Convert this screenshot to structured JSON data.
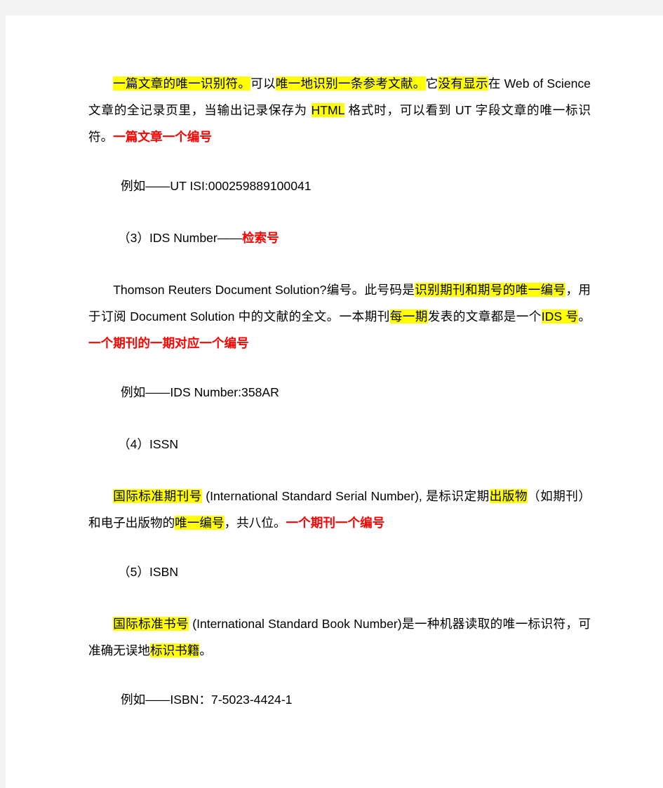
{
  "document": {
    "page_background": "#ffffff",
    "canvas_background": "#f4f4f4",
    "highlight_color": "#ffff00",
    "emphasis_color": "#ff0000",
    "text_color": "#000000",
    "paragraphs": [
      {
        "id": "ut-description",
        "type": "body",
        "runs": [
          {
            "text": "一篇文章的唯一识别符。",
            "style": "highlight"
          },
          {
            "text": "可以",
            "style": "plain"
          },
          {
            "text": "唯一地识别一条参考文献。",
            "style": "highlight"
          },
          {
            "text": "它",
            "style": "plain"
          },
          {
            "text": "没有显示",
            "style": "highlight"
          },
          {
            "text": "在 Web of Science 文章的全记录页里，当输出记录保存为 ",
            "style": "plain"
          },
          {
            "text": "HTML",
            "style": "highlight"
          },
          {
            "text": " 格式时，可以看到 UT 字段文章的唯一标识符。",
            "style": "plain"
          },
          {
            "text": "一篇文章一个编号",
            "style": "red-bold"
          }
        ]
      },
      {
        "id": "ut-example",
        "type": "example",
        "runs": [
          {
            "text": "例如——UT ISI:000259889100041",
            "style": "plain"
          }
        ]
      },
      {
        "id": "ids-heading",
        "type": "heading",
        "runs": [
          {
            "text": "（3）IDS Number——",
            "style": "plain"
          },
          {
            "text": "检索号",
            "style": "red-bold"
          }
        ]
      },
      {
        "id": "ids-description",
        "type": "body",
        "runs": [
          {
            "text": "Thomson Reuters Document Solution?编号。此号码是",
            "style": "plain"
          },
          {
            "text": "识别期刊和期号的唯一编号",
            "style": "highlight"
          },
          {
            "text": "，用于订阅 Document Solution 中的文献的全文。一本期刊",
            "style": "plain"
          },
          {
            "text": "每一期",
            "style": "highlight"
          },
          {
            "text": "发表的文章都是一个",
            "style": "plain"
          },
          {
            "text": "IDS 号",
            "style": "highlight"
          },
          {
            "text": "。",
            "style": "plain"
          },
          {
            "text": "一个期刊的一期对应一个编号",
            "style": "red-bold"
          }
        ]
      },
      {
        "id": "ids-example",
        "type": "example",
        "runs": [
          {
            "text": "例如——IDS Number:358AR",
            "style": "plain"
          }
        ]
      },
      {
        "id": "issn-heading",
        "type": "heading",
        "runs": [
          {
            "text": "（4）ISSN",
            "style": "plain"
          }
        ]
      },
      {
        "id": "issn-description",
        "type": "body",
        "runs": [
          {
            "text": "国际标准期刊号",
            "style": "highlight"
          },
          {
            "text": " (International Standard Serial Number), 是标识定期",
            "style": "plain"
          },
          {
            "text": "出版物",
            "style": "highlight"
          },
          {
            "text": "（如期刊）和电子出版物的",
            "style": "plain"
          },
          {
            "text": "唯一编号",
            "style": "highlight"
          },
          {
            "text": "，共八位。",
            "style": "plain"
          },
          {
            "text": "一个期刊一个编号",
            "style": "red-bold"
          }
        ]
      },
      {
        "id": "isbn-heading",
        "type": "heading",
        "runs": [
          {
            "text": "（5）ISBN",
            "style": "plain"
          }
        ]
      },
      {
        "id": "isbn-description",
        "type": "body",
        "runs": [
          {
            "text": "国际标准书号",
            "style": "highlight"
          },
          {
            "text": " (International Standard Book Number)是一种机器读取的唯一标识符，可准确无误地",
            "style": "plain"
          },
          {
            "text": "标识书籍",
            "style": "highlight"
          },
          {
            "text": "。",
            "style": "plain"
          }
        ]
      },
      {
        "id": "isbn-example",
        "type": "example",
        "runs": [
          {
            "text": "例如——ISBN：7-5023-4424-1",
            "style": "plain"
          }
        ]
      }
    ]
  }
}
